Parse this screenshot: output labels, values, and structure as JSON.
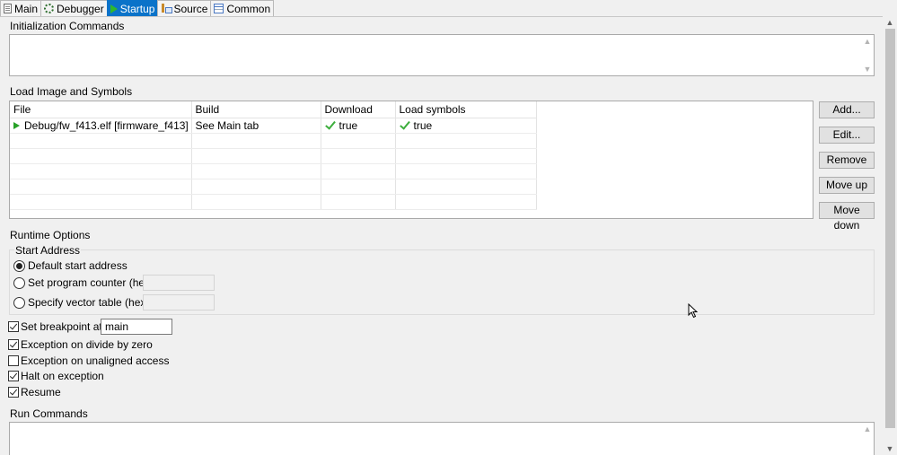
{
  "tabs": [
    {
      "label": "Main",
      "icon": "page-icon",
      "active": false
    },
    {
      "label": "Debugger",
      "icon": "gear-icon",
      "active": false
    },
    {
      "label": "Startup",
      "icon": "play-icon",
      "active": true
    },
    {
      "label": "Source",
      "icon": "source-icon",
      "active": false
    },
    {
      "label": "Common",
      "icon": "common-icon",
      "active": false
    }
  ],
  "init_commands": {
    "label": "Initialization Commands",
    "value": ""
  },
  "load_image": {
    "label": "Load Image and Symbols",
    "columns": [
      "File",
      "Build",
      "Download",
      "Load symbols"
    ],
    "rows": [
      {
        "file": "Debug/fw_f413.elf [firmware_f413]",
        "build": "See Main tab",
        "download": "true",
        "load_symbols": "true"
      }
    ],
    "buttons": {
      "add": "Add...",
      "edit": "Edit...",
      "remove": "Remove",
      "move_up": "Move up",
      "move_down": "Move down"
    }
  },
  "runtime": {
    "label": "Runtime Options",
    "start_address": {
      "label": "Start Address",
      "options": [
        {
          "label": "Default start address",
          "selected": true
        },
        {
          "label": "Set program counter (hex):",
          "selected": false,
          "value": ""
        },
        {
          "label": "Specify vector table (hex):",
          "selected": false,
          "value": ""
        }
      ]
    },
    "breakpoint": {
      "label": "Set breakpoint at:",
      "checked": true,
      "value": "main"
    },
    "divide_by_zero": {
      "label": "Exception on divide by zero",
      "checked": true
    },
    "unaligned": {
      "label": "Exception on unaligned access",
      "checked": false
    },
    "halt": {
      "label": "Halt on exception",
      "checked": true
    },
    "resume": {
      "label": "Resume",
      "checked": true
    }
  },
  "run_commands": {
    "label": "Run Commands",
    "value": ""
  },
  "colors": {
    "active_tab": "#0a73c9",
    "check": "#3cae3c",
    "play": "#27a127"
  }
}
